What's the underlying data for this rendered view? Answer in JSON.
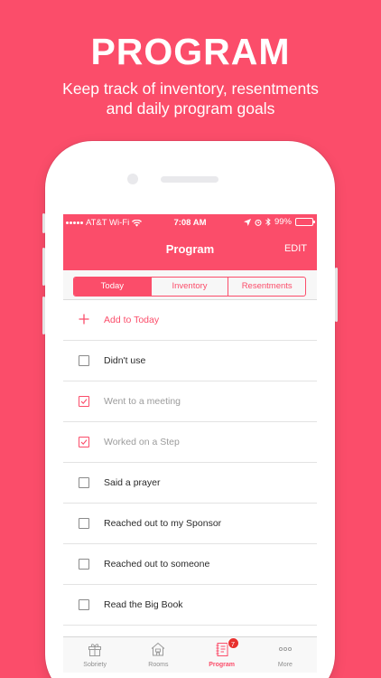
{
  "promo": {
    "headline": "PROGRAM",
    "subline_1": "Keep track of inventory, resentments",
    "subline_2": "and daily program goals"
  },
  "status_bar": {
    "carrier": "AT&T Wi-Fi",
    "time": "7:08 AM",
    "battery": "99%"
  },
  "nav": {
    "title": "Program",
    "edit_label": "EDIT"
  },
  "segments": [
    {
      "label": "Today",
      "active": true
    },
    {
      "label": "Inventory",
      "active": false
    },
    {
      "label": "Resentments",
      "active": false
    }
  ],
  "list": {
    "add_label": "Add to Today",
    "items": [
      {
        "label": "Didn't use",
        "checked": false
      },
      {
        "label": "Went to a meeting",
        "checked": true
      },
      {
        "label": "Worked on a Step",
        "checked": true
      },
      {
        "label": "Said a prayer",
        "checked": false
      },
      {
        "label": "Reached out to my Sponsor",
        "checked": false
      },
      {
        "label": "Reached out to someone",
        "checked": false
      },
      {
        "label": "Read the Big Book",
        "checked": false
      }
    ]
  },
  "tabs": [
    {
      "label": "Sobriety",
      "icon": "gift-icon",
      "active": false
    },
    {
      "label": "Rooms",
      "icon": "house-icon",
      "active": false
    },
    {
      "label": "Program",
      "icon": "notebook-icon",
      "active": true,
      "badge": "7"
    },
    {
      "label": "More",
      "icon": "more-dots-icon",
      "active": false
    }
  ],
  "colors": {
    "brand": "#FB4D6A",
    "badge": "#E8322F"
  }
}
